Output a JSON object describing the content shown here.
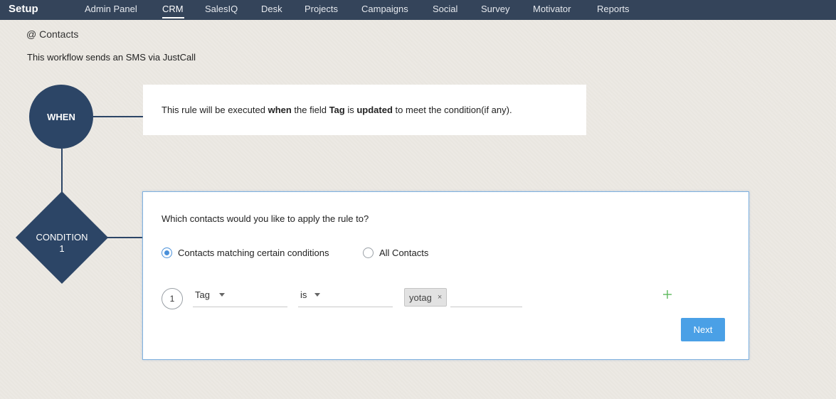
{
  "topbar": {
    "brand": "Setup",
    "nav": [
      "Admin Panel",
      "CRM",
      "SalesIQ",
      "Desk",
      "Projects",
      "Campaigns",
      "Social",
      "Survey",
      "Motivator",
      "Reports"
    ],
    "active": "CRM"
  },
  "header": {
    "module": "@ Contacts",
    "description": "This workflow sends an SMS via JustCall"
  },
  "flow": {
    "when_label": "WHEN",
    "condition_label_line1": "CONDITION",
    "condition_label_line2": "1"
  },
  "when_box": {
    "part1": "This rule will be executed ",
    "bold1": "when",
    "part2": " the field ",
    "bold2": "Tag",
    "part3": " is ",
    "bold3": "updated",
    "part4": " to meet the condition(if any)."
  },
  "condition": {
    "question": "Which contacts would you like to apply the rule to?",
    "options": [
      {
        "label": "Contacts matching certain conditions",
        "checked": true
      },
      {
        "label": "All Contacts",
        "checked": false
      }
    ],
    "row": {
      "number": "1",
      "field": "Tag",
      "operator": "is",
      "tag_value": "yotag",
      "remove_symbol": "×"
    },
    "next_label": "Next"
  },
  "colors": {
    "topbar": "#34445a",
    "flow_shape": "#2c4566",
    "accent": "#4aa0e6",
    "add_icon": "#5cb85c"
  },
  "icons": {
    "add": "plus-icon",
    "remove": "close-icon",
    "caret": "chevron-down-icon"
  }
}
